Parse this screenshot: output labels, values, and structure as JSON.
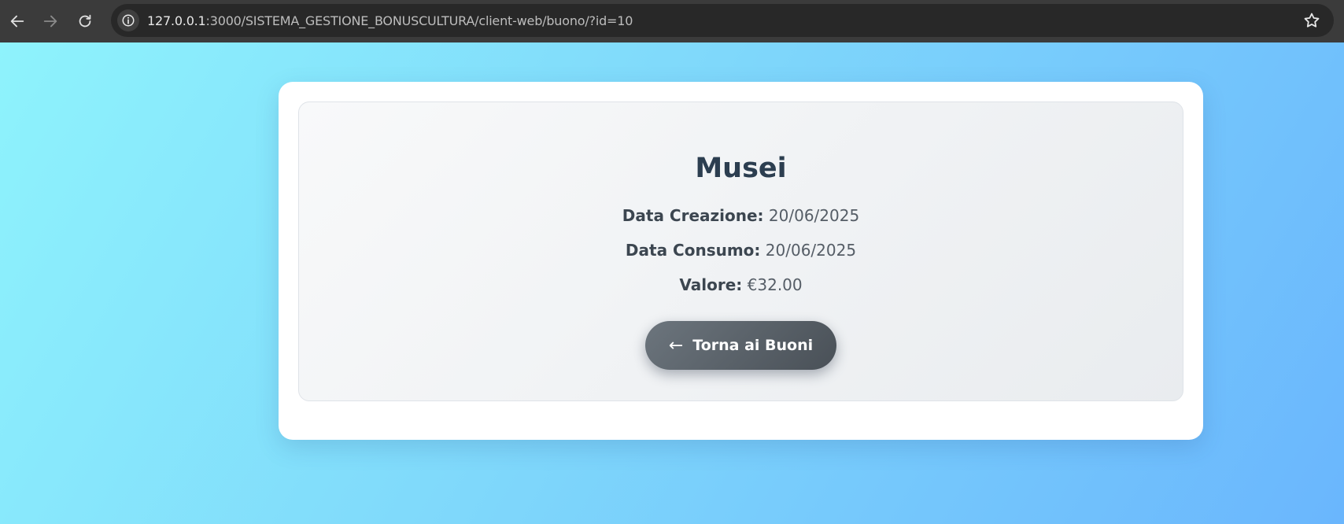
{
  "browser": {
    "url_host": "127.0.0.1",
    "url_rest": ":3000/SISTEMA_GESTIONE_BONUSCULTURA/client-web/buono/?id=10"
  },
  "voucher": {
    "title": "Musei",
    "creation_label": "Data Creazione:",
    "creation_value": "20/06/2025",
    "consumption_label": "Data Consumo:",
    "consumption_value": "20/06/2025",
    "value_label": "Valore:",
    "value_value": "€32.00"
  },
  "actions": {
    "back_arrow": "←",
    "back_label": "Torna ai Buoni"
  },
  "colors": {
    "browser_bar": "#3b3b3b",
    "url_bar": "#282828",
    "title": "#2c3e50",
    "button": "#5a6268"
  }
}
